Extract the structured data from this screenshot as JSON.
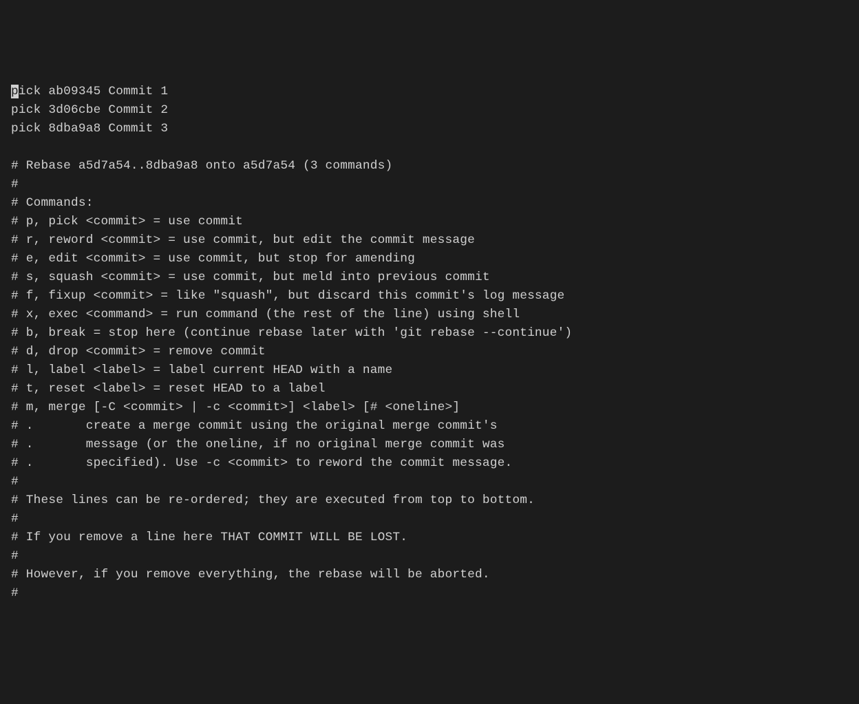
{
  "lines": [
    {
      "cursor_char": "p",
      "rest": "ick ab09345 Commit 1"
    },
    {
      "text": "pick 3d06cbe Commit 2"
    },
    {
      "text": "pick 8dba9a8 Commit 3"
    },
    {
      "text": ""
    },
    {
      "text": "# Rebase a5d7a54..8dba9a8 onto a5d7a54 (3 commands)"
    },
    {
      "text": "#"
    },
    {
      "text": "# Commands:"
    },
    {
      "text": "# p, pick <commit> = use commit"
    },
    {
      "text": "# r, reword <commit> = use commit, but edit the commit message"
    },
    {
      "text": "# e, edit <commit> = use commit, but stop for amending"
    },
    {
      "text": "# s, squash <commit> = use commit, but meld into previous commit"
    },
    {
      "text": "# f, fixup <commit> = like \"squash\", but discard this commit's log message"
    },
    {
      "text": "# x, exec <command> = run command (the rest of the line) using shell"
    },
    {
      "text": "# b, break = stop here (continue rebase later with 'git rebase --continue')"
    },
    {
      "text": "# d, drop <commit> = remove commit"
    },
    {
      "text": "# l, label <label> = label current HEAD with a name"
    },
    {
      "text": "# t, reset <label> = reset HEAD to a label"
    },
    {
      "text": "# m, merge [-C <commit> | -c <commit>] <label> [# <oneline>]"
    },
    {
      "text": "# .       create a merge commit using the original merge commit's"
    },
    {
      "text": "# .       message (or the oneline, if no original merge commit was"
    },
    {
      "text": "# .       specified). Use -c <commit> to reword the commit message."
    },
    {
      "text": "#"
    },
    {
      "text": "# These lines can be re-ordered; they are executed from top to bottom."
    },
    {
      "text": "#"
    },
    {
      "text": "# If you remove a line here THAT COMMIT WILL BE LOST."
    },
    {
      "text": "#"
    },
    {
      "text": "# However, if you remove everything, the rebase will be aborted."
    },
    {
      "text": "#"
    }
  ]
}
